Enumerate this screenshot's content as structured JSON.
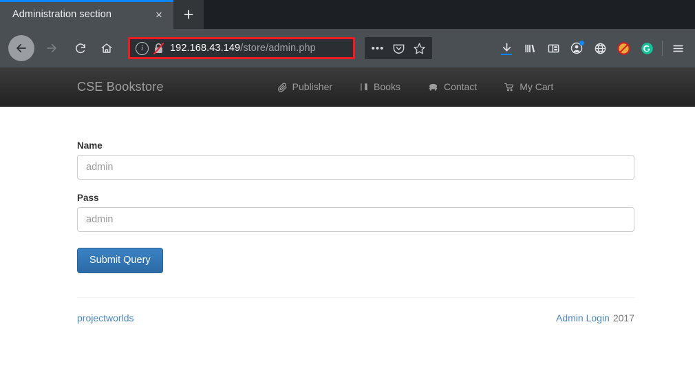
{
  "browser": {
    "tab": {
      "title": "Administration section",
      "close_label": "×",
      "newtab_label": "+"
    },
    "nav": {
      "back_icon": "back-arrow-icon",
      "forward_icon": "forward-arrow-icon",
      "reload_icon": "reload-icon",
      "home_icon": "home-icon"
    },
    "url": {
      "info_glyph": "i",
      "host": "192.168.43.149",
      "path": "/store/admin.php",
      "security_icon": "broken-lock-icon",
      "highlight_color": "#ee1c22"
    },
    "page_actions": {
      "more_label": "•••",
      "pocket_icon": "pocket-icon",
      "bookmark_icon": "star-icon"
    },
    "toolbar_icons": [
      "downloads-icon",
      "library-icon",
      "sidebar-icon",
      "account-icon",
      "globe-icon",
      "noscript-icon",
      "grammarly-icon",
      "menu-icon"
    ]
  },
  "site": {
    "brand": "CSE Bookstore",
    "navlinks": [
      {
        "label": "Publisher",
        "icon": "paperclip-icon"
      },
      {
        "label": "Books",
        "icon": "book-icon"
      },
      {
        "label": "Contact",
        "icon": "phone-icon"
      },
      {
        "label": "My Cart",
        "icon": "cart-icon"
      }
    ],
    "form": {
      "name_label": "Name",
      "name_value": "",
      "name_placeholder": "admin",
      "pass_label": "Pass",
      "pass_value": "",
      "pass_placeholder": "admin",
      "submit_label": "Submit Query"
    },
    "footer": {
      "left_link": "projectworlds",
      "right_link": "Admin Login",
      "year": "2017"
    }
  }
}
